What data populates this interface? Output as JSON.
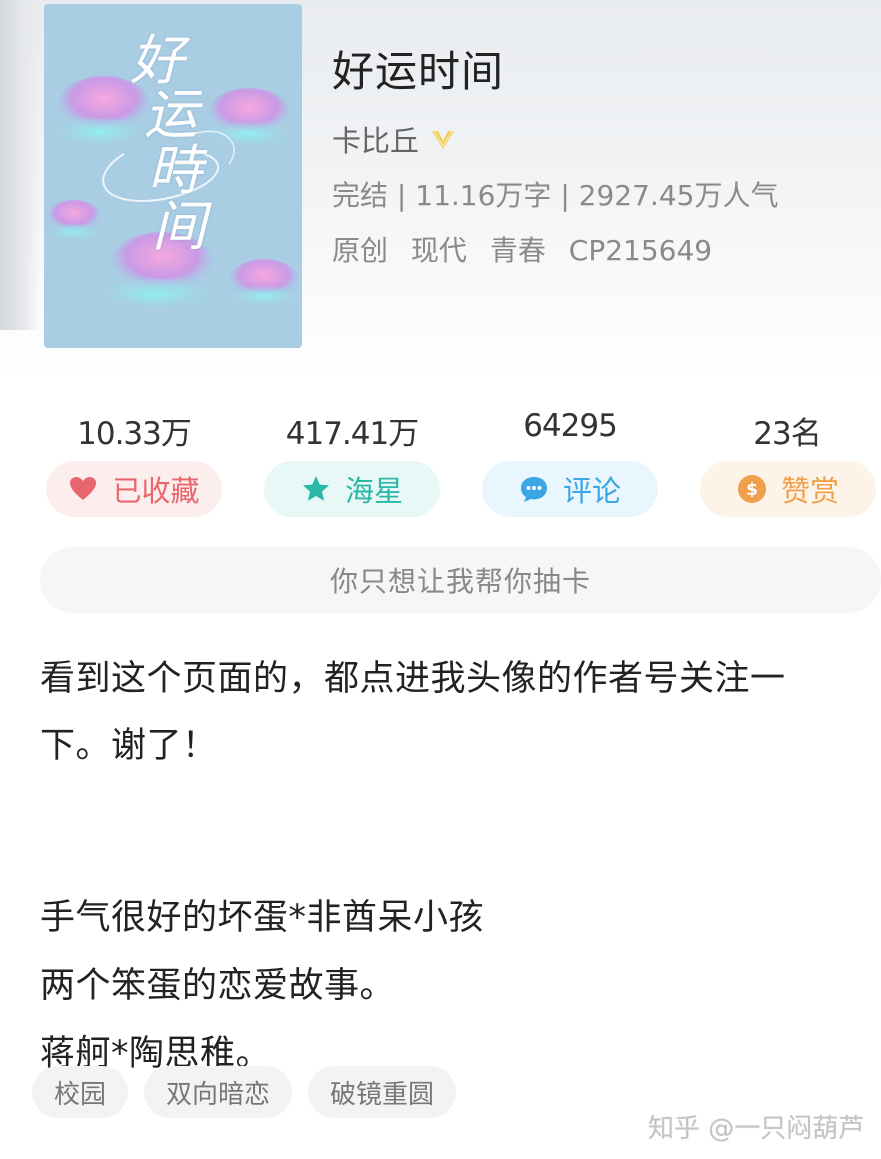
{
  "book": {
    "title": "好运时间",
    "author": "卡比丘",
    "cover_title_chars": [
      "好",
      "运",
      "時",
      "间"
    ],
    "meta": {
      "status": "完结",
      "sep1": " | ",
      "words": "11.16万字",
      "sep2": " | ",
      "popularity": "2927.45万人气"
    },
    "tags_line": {
      "origin": "原创",
      "era": "现代",
      "genre": "青春",
      "code": "CP215649"
    }
  },
  "stats": {
    "favorites": "10.33万",
    "stars": "417.41万",
    "comments": "64295",
    "reward_rank": "23名"
  },
  "actions": {
    "favorite_label": "已收藏",
    "star_label": "海星",
    "comment_label": "评论",
    "reward_label": "赞赏"
  },
  "quote": "你只想让我帮你抽卡",
  "description": {
    "line1": "看到这个页面的，都点进我头像的作者号关注一",
    "line2": "下。谢了！",
    "line3": "手气很好的坏蛋*非酋呆小孩",
    "line4": "两个笨蛋的恋爱故事。",
    "line5": "蒋舸*陶思稚。"
  },
  "tags": [
    "校园",
    "双向暗恋",
    "破镜重圆"
  ],
  "watermark": "知乎 @一只闷葫芦",
  "icons": {
    "vip": "vip-heart-icon",
    "favorite": "heart-icon",
    "star": "star-icon",
    "comment": "chat-bubble-icon",
    "reward": "dollar-coin-icon"
  },
  "colors": {
    "favorite": "#e8676f",
    "star": "#2cb8a8",
    "comment": "#3aa7e4",
    "reward": "#f0a04c",
    "cover_bg": "#a9cde3"
  }
}
